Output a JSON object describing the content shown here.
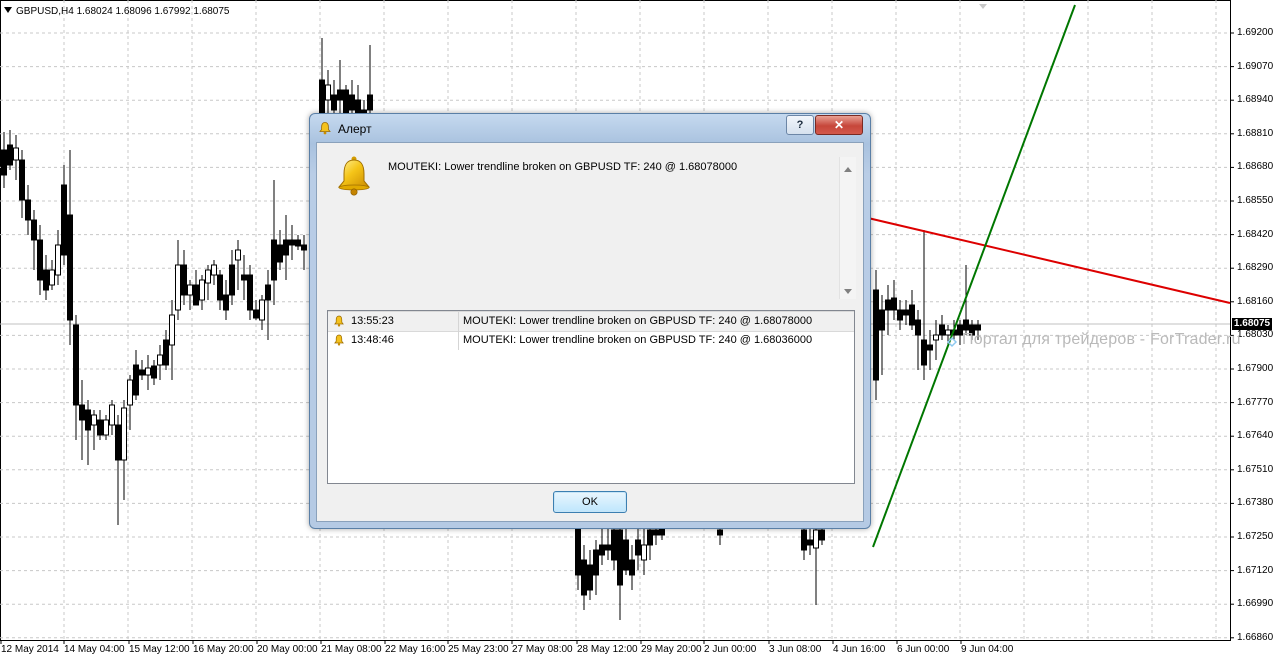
{
  "chart": {
    "symbol_header": "GBPUSD,H4  1.68024 1.68096 1.67992 1.68075",
    "current_price": "1.68075",
    "watermark": "Портал для трейдеров - ForTrader.ru",
    "price_axis": [
      "1.69200",
      "1.69070",
      "1.68940",
      "1.68810",
      "1.68680",
      "1.68550",
      "1.68420",
      "1.68290",
      "1.68160",
      "1.68030",
      "1.67900",
      "1.67770",
      "1.67640",
      "1.67510",
      "1.67380",
      "1.67250",
      "1.67120",
      "1.66990",
      "1.66860"
    ],
    "time_axis": [
      "12 May 2014",
      "14 May 04:00",
      "15 May 12:00",
      "16 May 20:00",
      "20 May 00:00",
      "21 May 08:00",
      "22 May 16:00",
      "25 May 23:00",
      "27 May 08:00",
      "28 May 12:00",
      "29 May 20:00",
      "2 Jun 00:00",
      "3 Jun 08:00",
      "4 Jun 16:00",
      "6 Jun 00:00",
      "9 Jun 04:00"
    ],
    "colors": {
      "trendline_upper": "#dd0000",
      "trendline_lower": "#007700",
      "grid": "#c8c8c8",
      "candle": "#000000"
    }
  },
  "dialog": {
    "title": "Алерт",
    "help_label": "?",
    "close_label": "✕",
    "message": "MOUTEKI: Lower trendline broken on GBPUSD TF: 240 @ 1.68078000",
    "alerts": [
      {
        "time": "13:55:23",
        "message": "MOUTEKI: Lower trendline broken on GBPUSD TF: 240 @ 1.68078000"
      },
      {
        "time": "13:48:46",
        "message": "MOUTEKI: Lower trendline broken on GBPUSD TF: 240 @ 1.68036000"
      }
    ],
    "ok_label": "OK",
    "icons": {
      "title": "bell-icon",
      "message": "bell-icon",
      "row": "bell-icon"
    }
  }
}
